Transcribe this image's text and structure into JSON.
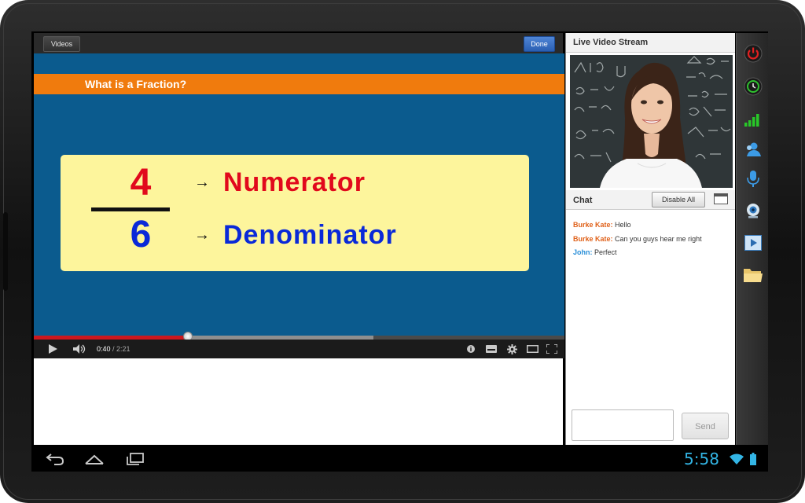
{
  "video": {
    "videos_button": "Videos",
    "done_button": "Done",
    "slide": {
      "title": "What is a Fraction?",
      "numerator_digit": "4",
      "denominator_digit": "6",
      "arrow": "→",
      "numerator_term": "Numerator",
      "denominator_term": "Denominator"
    },
    "player": {
      "current_time": "0:40",
      "separator": " / ",
      "duration": "2:21",
      "played_fraction": 0.29,
      "buffered_fraction": 0.64
    }
  },
  "stream": {
    "title": "Live Video Stream"
  },
  "chat": {
    "title": "Chat",
    "disable_all_button": "Disable All",
    "messages": [
      {
        "sender": "Burke Kate:",
        "text": " Hello",
        "color": "#e0621b"
      },
      {
        "sender": "Burke Kate:",
        "text": " Can you guys hear me right",
        "color": "#e0621b"
      },
      {
        "sender": "John:",
        "text": " Perfect",
        "color": "#2a8fd8"
      }
    ],
    "input_value": "",
    "send_button": "Send"
  },
  "sidebar": {
    "icons": [
      "power-icon",
      "clock-icon",
      "signal-bars-icon",
      "user-icon",
      "microphone-icon",
      "webcam-icon",
      "media-player-icon",
      "folder-icon"
    ]
  },
  "system_bar": {
    "clock": "5:58"
  },
  "colors": {
    "slide_background": "#0b5b8e",
    "title_bar": "#f07b0d",
    "card": "#fdf59c",
    "numerator": "#e1091c",
    "denominator": "#0a29d8",
    "progress_played": "#cc181e",
    "clock": "#33b5e5"
  }
}
